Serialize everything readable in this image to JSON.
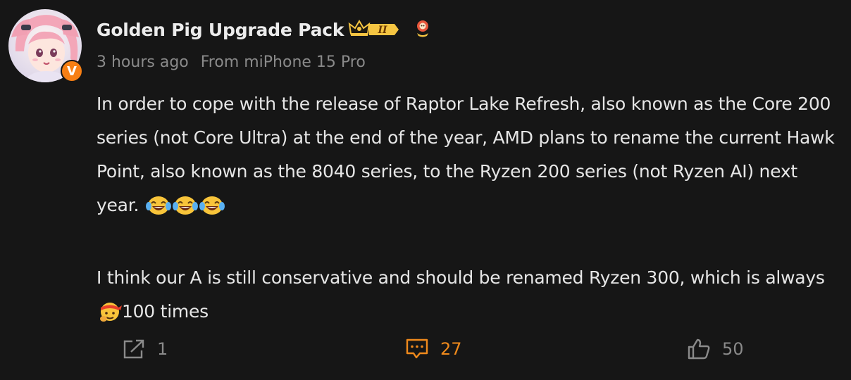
{
  "post": {
    "author": {
      "name": "Golden Pig Upgrade Pack",
      "verified_badge_text": "V",
      "vip_level_text": "II"
    },
    "meta": {
      "time": "3 hours ago",
      "source": "From miPhone 15 Pro"
    },
    "content": {
      "paragraph1": "In order to cope with the release of Raptor Lake Refresh, also known as the Core 200 series (not Core Ultra) at the end of the year, AMD plans to rename the current Hawk Point, also known as the 8040 series, to the Ryzen 200 series (not Ryzen AI) next year.",
      "paragraph1_emojis": [
        "laughing-tears-emoji",
        "laughing-tears-emoji",
        "laughing-tears-emoji"
      ],
      "paragraph2_before": "I think our A is still conservative and should be renamed Ryzen 300, which is always",
      "paragraph2_emoji": "determined-headband-emoji",
      "paragraph2_after": "100 times"
    },
    "actions": {
      "share_count": "1",
      "comment_count": "27",
      "like_count": "50"
    }
  },
  "colors": {
    "background": "#161616",
    "text": "#e6e6e6",
    "muted": "#8a8a8a",
    "accent": "#f08a1c",
    "badge": "#f77f14",
    "vip_gold": "#f5c542"
  }
}
